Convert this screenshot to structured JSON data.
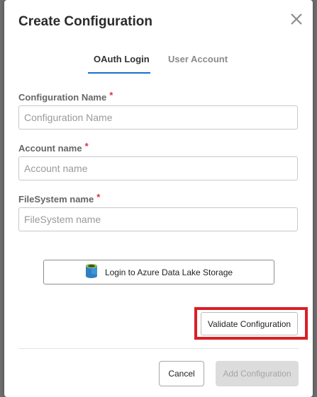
{
  "dialog": {
    "title": "Create Configuration"
  },
  "tabs": [
    {
      "label": "OAuth Login",
      "active": true
    },
    {
      "label": "User Account",
      "active": false
    }
  ],
  "fields": [
    {
      "label": "Configuration Name",
      "required": "*",
      "placeholder": "Configuration Name",
      "value": ""
    },
    {
      "label": "Account name",
      "required": "*",
      "placeholder": "Account name",
      "value": ""
    },
    {
      "label": "FileSystem name",
      "required": "*",
      "placeholder": "FileSystem name",
      "value": ""
    }
  ],
  "login_button": {
    "label": "Login to Azure Data Lake Storage",
    "icon": "azure-storage-icon"
  },
  "validate_button": {
    "label": "Validate Configuration",
    "highlight_color": "#d91f26"
  },
  "footer": {
    "cancel_label": "Cancel",
    "add_label": "Add Configuration",
    "add_disabled": true
  },
  "colors": {
    "accent": "#1a6fc9",
    "required": "#d9304a"
  }
}
